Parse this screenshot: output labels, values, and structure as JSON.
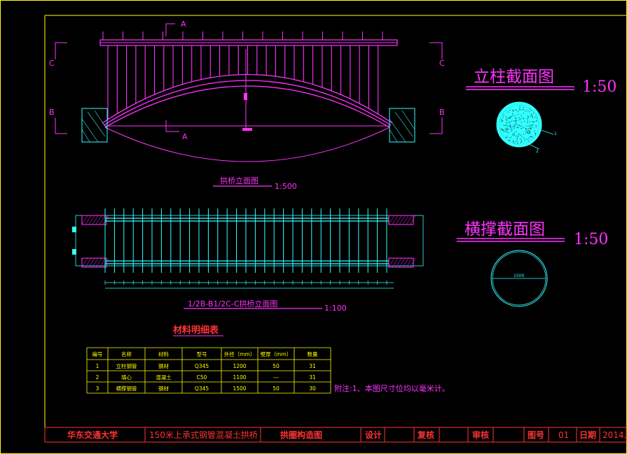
{
  "colors": {
    "background": "#000000",
    "frame": "#ffff00",
    "magenta": "#ff33ff",
    "cyan": "#33ffff",
    "red": "#ff3333",
    "white": "#ffffff"
  },
  "elevation": {
    "section_a_top": "A",
    "section_a_bottom": "A",
    "section_c_left": "C",
    "section_c_right": "C",
    "section_b_left": "B",
    "section_b_right": "B",
    "caption": "拱桥立面图",
    "scale": "1:500"
  },
  "column_section": {
    "title": "立柱截面图",
    "scale": "1:50",
    "leader_1": "1",
    "leader_2": "2"
  },
  "brace_section": {
    "title": "横撑截面图",
    "scale": "1:50",
    "diameter": "1500"
  },
  "plan": {
    "caption": "1/2B-B1/2C-C拱桥立面图",
    "scale": "1:100"
  },
  "material_table": {
    "title": "材料明细表",
    "headers": [
      "编号",
      "名称",
      "材料",
      "型号",
      "外径（mm）",
      "壁厚（mm）",
      "数量"
    ],
    "rows": [
      [
        "1",
        "立柱钢管",
        "钢材",
        "Q345",
        "1200",
        "50",
        "31"
      ],
      [
        "2",
        "填心",
        "混凝土",
        "C50",
        "1100",
        "---",
        "31"
      ],
      [
        "3",
        "横撑钢管",
        "钢材",
        "Q345",
        "1500",
        "50",
        "30"
      ]
    ]
  },
  "note": "附注:1、本图尺寸位均以毫米计。",
  "title_block": {
    "school": "华东交通大学",
    "project": "150米上承式钢管混凝土拱桥",
    "drawing_name": "拱圈构造图",
    "design_label": "设计",
    "review_label": "复核",
    "audit_label": "审核",
    "drawing_no_label": "图号",
    "drawing_no": "01",
    "date_label": "日期",
    "date": "2014.0"
  }
}
